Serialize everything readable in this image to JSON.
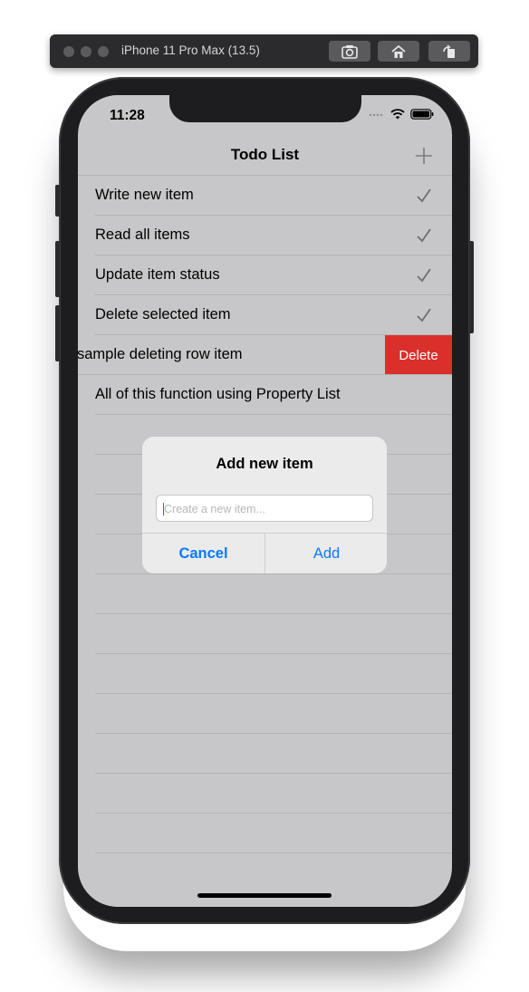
{
  "simulator": {
    "title": "iPhone 11 Pro Max (13.5)"
  },
  "status": {
    "time": "11:28"
  },
  "nav": {
    "title": "Todo List"
  },
  "items": [
    {
      "label": "Write new item",
      "checked": true
    },
    {
      "label": "Read all items",
      "checked": true
    },
    {
      "label": "Update item status",
      "checked": true
    },
    {
      "label": "Delete selected item",
      "checked": true
    },
    {
      "label": "sample deleting row item",
      "checked": false
    },
    {
      "label": "All of this function using Property List",
      "checked": false
    }
  ],
  "swipe": {
    "delete_label": "Delete"
  },
  "alert": {
    "title": "Add new item",
    "placeholder": "Create a new item...",
    "cancel_label": "Cancel",
    "add_label": "Add"
  },
  "colors": {
    "accent": "#0a7aff",
    "delete": "#d9302b"
  }
}
